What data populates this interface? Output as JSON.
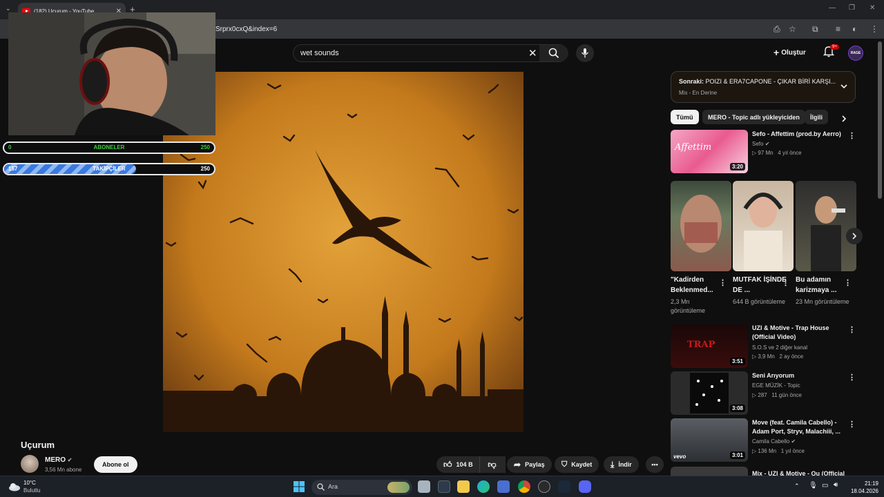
{
  "browser": {
    "tab_title": "(182) Uçurum - YouTube",
    "url": "Srprx0cxQ&index=6"
  },
  "header": {
    "search_query": "wet sounds",
    "create_label": "Oluştur",
    "notification_count": "9+",
    "avatar_text": "RAGE"
  },
  "overlay": {
    "subscribers": {
      "left": "0",
      "label": "ABONELER",
      "right": "250",
      "progress": 0
    },
    "followers": {
      "left": "157",
      "label": "TAKİPÇİLER",
      "right": "250",
      "progress": 0.628
    }
  },
  "video": {
    "title": "Uçurum",
    "channel": "MERO",
    "subscribers": "3,56 Mn abone",
    "subscribe_label": "Abone ol",
    "like_count": "104 B",
    "share_label": "Paylaş",
    "save_label": "Kaydet",
    "download_label": "İndir"
  },
  "next_up": {
    "prefix": "Sonraki:",
    "title": "POIZI & ERA7CAPONE - ÇIKAR BİRİ KARŞI...",
    "subtitle": "Mix - En Derine"
  },
  "chips": [
    "Tümü",
    "MERO - Topic adlı yükleyiciden",
    "İlgili"
  ],
  "recommendations": [
    {
      "title": "Sefo - Affettim (prod.by Aerro)",
      "channel": "Sefo",
      "meta": "97 Mn   4 yıl önce",
      "duration": "3:20"
    },
    {
      "title": "UZI & Motive - Trap House (Official Video)",
      "channel": "S.O.S ve 2 diğer kanal",
      "meta": "3,9 Mn   2 ay önce",
      "duration": "3:51"
    },
    {
      "title": "Seni Arıyorum",
      "channel": "EGE MÜZİK - Topic",
      "meta": "287   11 gün önce",
      "duration": "3:08"
    },
    {
      "title": "Move (feat. Camila Cabello) - Adam Port, Stryv, Malachiii, ...",
      "channel": "Camila Cabello",
      "meta": "136 Mn   1 yıl önce",
      "duration": "3:01"
    },
    {
      "title": "Mix - UZI & Motive - Qu (Official",
      "channel": "",
      "meta": "",
      "duration": ""
    }
  ],
  "shorts": [
    {
      "title": "\"Kadirden Beklenmed...",
      "views": "2,3 Mn görüntüleme"
    },
    {
      "title": "MUTFAK İŞİNDE DE ...",
      "views": "644 B görüntüleme"
    },
    {
      "title": "Bu adamın karizmaya ...",
      "views": "23 Mn görüntüleme"
    }
  ],
  "taskbar": {
    "temperature": "10°C",
    "condition": "Bulutlu",
    "search_placeholder": "Ara",
    "time": "21:19",
    "date": "18.04.2026"
  }
}
